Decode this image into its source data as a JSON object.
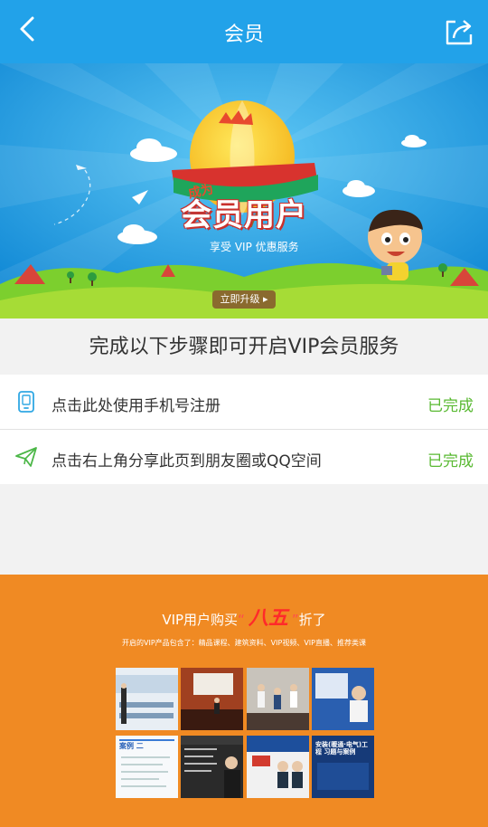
{
  "header": {
    "title": "会员"
  },
  "banner": {
    "badge_top": "成为",
    "badge_main": "会员用户",
    "ribbon": "享受 VIP 优惠服务",
    "upgrade_label": "立即升级 ▸"
  },
  "headline": "完成以下步骤即可开启VIP会员服务",
  "tasks": [
    {
      "icon": "phone-icon",
      "label": "点击此处使用手机号注册",
      "status": "已完成"
    },
    {
      "icon": "paper-plane-icon",
      "label": "点击右上角分享此页到朋友圈或QQ空间",
      "status": "已完成"
    }
  ],
  "promo": {
    "title_pre": "VIP用户购买",
    "title_quote_open": "“",
    "title_big": "八五",
    "title_quote_close": "”",
    "title_post": "折了",
    "subtitle": "开启的VIP产品包含了：精品课程、建筑资料、VIP视频、VIP直播、推荐类课",
    "thumb_captions": [
      "案例 二",
      "安装(暖通·电气)工程 习题与案例"
    ]
  },
  "colors": {
    "accent": "#22a2e9",
    "done": "#59b932",
    "promo_bg": "#f08a23"
  }
}
